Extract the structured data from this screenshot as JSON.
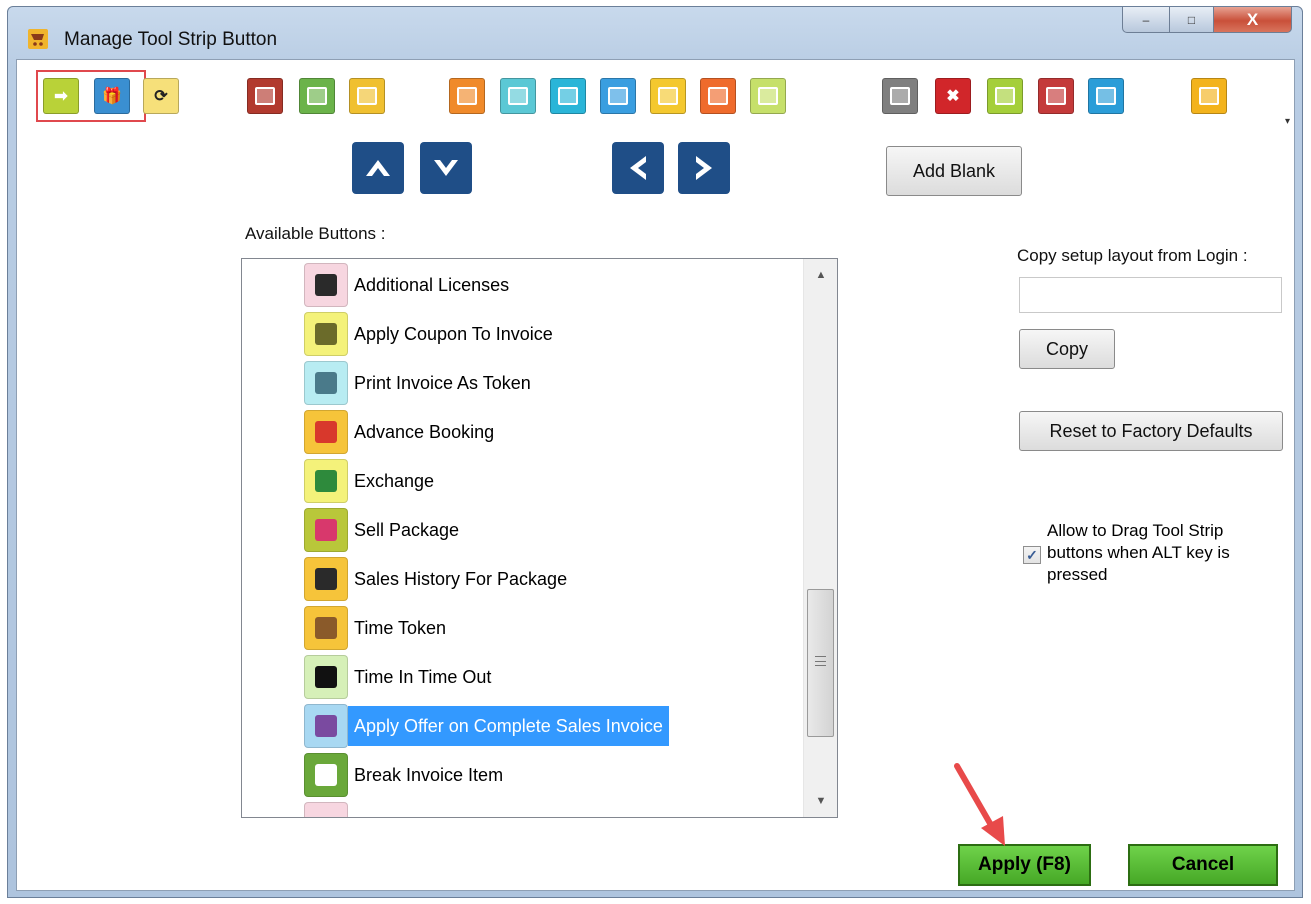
{
  "window": {
    "title": "Manage Tool Strip Button",
    "buttons": {
      "minimize": "‒",
      "maximize": "□",
      "close": "X"
    }
  },
  "toolbar": {
    "buttons": [
      {
        "name": "toolbar-btn-1",
        "color": "#b9d238",
        "glyph": "➡"
      },
      {
        "name": "toolbar-btn-2",
        "color": "#3a8fd1",
        "glyph": "🎁"
      },
      {
        "name": "toolbar-btn-refresh",
        "color": "#f6e07a",
        "glyph": "⟳"
      },
      {
        "name": "toolbar-btn-4",
        "color": "#b23a2e",
        "glyph": ""
      },
      {
        "name": "toolbar-btn-5",
        "color": "#6bb34a",
        "glyph": ""
      },
      {
        "name": "toolbar-btn-6",
        "color": "#f0c030",
        "glyph": ""
      },
      {
        "name": "toolbar-btn-7",
        "color": "#f08a2a",
        "glyph": ""
      },
      {
        "name": "toolbar-btn-8",
        "color": "#5bc8d5",
        "glyph": ""
      },
      {
        "name": "toolbar-btn-9",
        "color": "#2ab5d8",
        "glyph": ""
      },
      {
        "name": "toolbar-btn-10",
        "color": "#3a9ee0",
        "glyph": ""
      },
      {
        "name": "toolbar-btn-11",
        "color": "#f4c82e",
        "glyph": ""
      },
      {
        "name": "toolbar-btn-12",
        "color": "#ef6b2c",
        "glyph": ""
      },
      {
        "name": "toolbar-btn-13",
        "color": "#c6e06a",
        "glyph": ""
      },
      {
        "name": "toolbar-btn-14",
        "color": "#7f7f7f",
        "glyph": ""
      },
      {
        "name": "toolbar-btn-15",
        "color": "#d1262a",
        "glyph": "✖"
      },
      {
        "name": "toolbar-btn-calculator",
        "color": "#a5cf3a",
        "glyph": ""
      },
      {
        "name": "toolbar-btn-17",
        "color": "#c43a3a",
        "glyph": ""
      },
      {
        "name": "toolbar-btn-18",
        "color": "#2b9dd8",
        "glyph": ""
      },
      {
        "name": "toolbar-btn-19",
        "color": "#f3b31c",
        "glyph": ""
      }
    ],
    "overflow": "▾"
  },
  "buttons": {
    "add_blank": "Add Blank",
    "copy": "Copy",
    "reset": "Reset to Factory Defaults",
    "apply": "Apply (F8)",
    "cancel": "Cancel"
  },
  "labels": {
    "available_buttons": "Available  Buttons :",
    "copy_layout": "Copy setup layout from Login :",
    "allow_drag": "Allow to Drag Tool Strip buttons when ALT key is pressed"
  },
  "copy_login_value": "",
  "allow_drag_checked": "✓",
  "available_buttons": [
    {
      "label": "Additional Licenses",
      "bg": "#f7d6e0",
      "fg": "#2a2a2a"
    },
    {
      "label": "Apply Coupon To Invoice",
      "bg": "#f4f27a",
      "fg": "#6b6b2a"
    },
    {
      "label": "Print Invoice As Token",
      "bg": "#b8ecf2",
      "fg": "#4a7a8a"
    },
    {
      "label": "Advance Booking",
      "bg": "#f6c43a",
      "fg": "#d8382c"
    },
    {
      "label": "Exchange",
      "bg": "#f4f27a",
      "fg": "#2e8a3c"
    },
    {
      "label": "Sell Package",
      "bg": "#b9c73a",
      "fg": "#d8386c"
    },
    {
      "label": "Sales History For Package",
      "bg": "#f6c43a",
      "fg": "#2a2a2a"
    },
    {
      "label": "Time Token",
      "bg": "#f6c43a",
      "fg": "#8a5a2a"
    },
    {
      "label": "Time In Time Out",
      "bg": "#d6f0b8",
      "fg": "#111111"
    },
    {
      "label": "Apply Offer on Complete Sales Invoice",
      "bg": "#a8d8f2",
      "fg": "#7a4aa0",
      "selected": true
    },
    {
      "label": "Break Invoice Item",
      "bg": "#6aa83a",
      "fg": "#ffffff"
    },
    {
      "label": "",
      "bg": "#f7d6e0",
      "fg": "#f7d6e0"
    }
  ],
  "scrollbar": {
    "up": "▲",
    "down": "▼"
  }
}
